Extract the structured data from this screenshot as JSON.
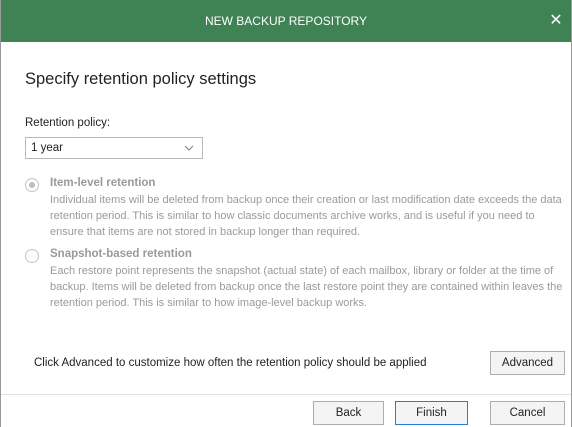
{
  "dialog": {
    "title": "NEW BACKUP REPOSITORY",
    "close_label": "✕",
    "heading": "Specify retention policy settings"
  },
  "retention": {
    "label": "Retention policy:",
    "selected": "1 year",
    "options": [
      {
        "title": "Item-level retention",
        "checked": true,
        "enabled": false,
        "description": "Individual items will be deleted from backup once their creation or last modification date exceeds the data retention period. This is similar to how classic documents archive works, and is useful if you need to ensure that items are not stored in backup longer than required."
      },
      {
        "title": "Snapshot-based retention",
        "checked": false,
        "enabled": false,
        "description": "Each restore point represents the snapshot (actual state) of each mailbox, library or folder at the time of backup. Items will be deleted from backup once the last restore point they are contained within leaves the retention period. This is similar to how image-level backup works."
      }
    ]
  },
  "advanced": {
    "note": "Click Advanced to customize how often the retention policy should be applied",
    "button_label": "Advanced"
  },
  "buttons": {
    "back": "Back",
    "finish": "Finish",
    "cancel": "Cancel"
  },
  "colors": {
    "titlebar": "#3f8254",
    "primary_border": "#2b7bd6",
    "disabled_text": "#9a9a9a"
  }
}
